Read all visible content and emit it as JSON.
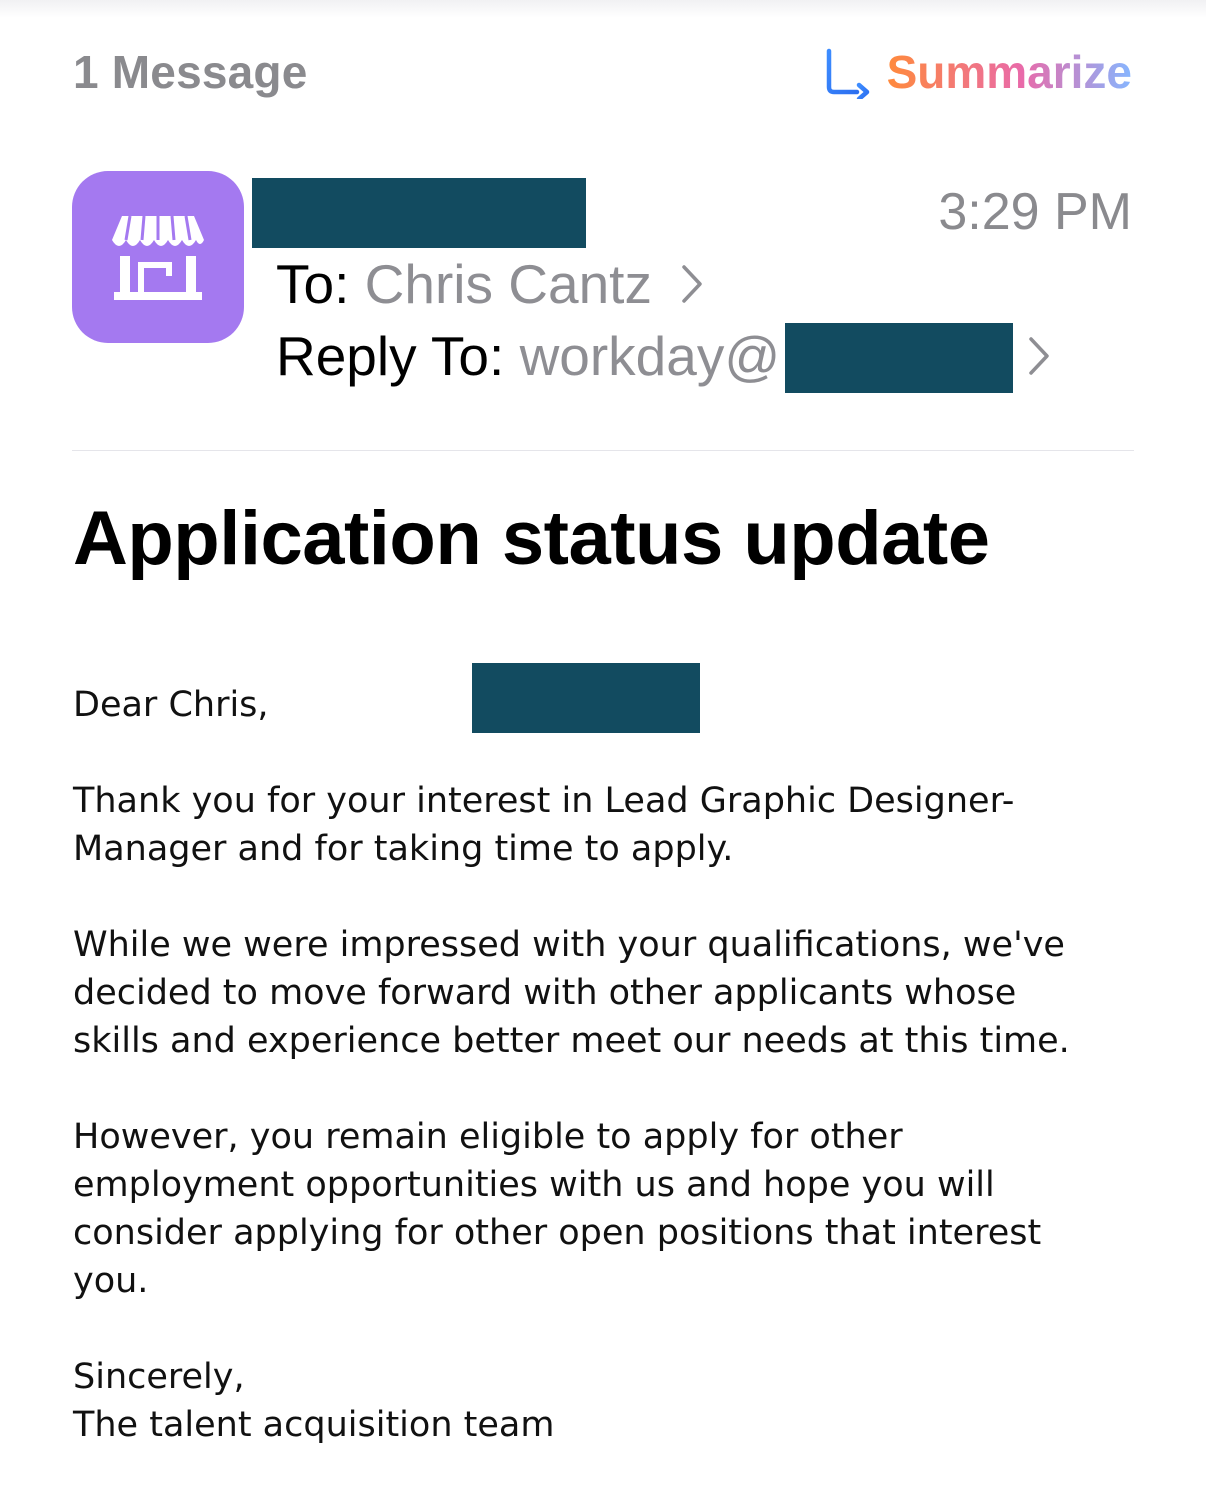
{
  "header": {
    "message_count": "1 Message",
    "summarize_label": "Summarize",
    "summarize_icon": "summarize-icon"
  },
  "sender": {
    "avatar_icon": "storefront-icon",
    "avatar_color": "#a479f0",
    "time": "3:29 PM",
    "to_label": "To:",
    "to_value": "Chris Cantz",
    "reply_to_label": "Reply To:",
    "reply_to_value": "workday@",
    "redaction_color": "#124b60"
  },
  "email": {
    "subject": "Application status update",
    "greeting": "Dear Chris,",
    "paragraph_1_line_1": "Thank you for your interest in Lead Graphic Designer-",
    "paragraph_1_line_2": "Manager and for taking time to apply.",
    "paragraph_2_line_1": "While we were impressed with your qualifications, we've",
    "paragraph_2_line_2": "decided to move forward with other applicants whose",
    "paragraph_2_line_3": "skills and experience better meet our needs at this time.",
    "paragraph_3_line_1": "However, you remain eligible to apply for other",
    "paragraph_3_line_2": "employment opportunities with us and hope you will",
    "paragraph_3_line_3": "consider applying for other open positions that interest",
    "paragraph_3_line_4": "you.",
    "closing": "Sincerely,",
    "signature": "The talent acquisition team"
  }
}
